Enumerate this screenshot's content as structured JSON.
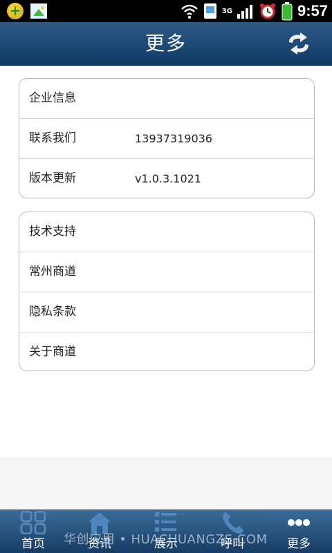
{
  "status_bar": {
    "time": "9:57",
    "network": "3G",
    "left_icons": [
      "app-badge-icon",
      "image-icon"
    ],
    "right_icons": [
      "wifi-icon",
      "sim-icon",
      "signal-icon",
      "alarm-icon",
      "battery-icon"
    ]
  },
  "header": {
    "title": "更多",
    "refresh_icon": "refresh-icon"
  },
  "groups": [
    {
      "rows": [
        {
          "label": "企业信息",
          "value": ""
        },
        {
          "label": "联系我们",
          "value": "13937319036"
        },
        {
          "label": "版本更新",
          "value": "v1.0.3.1021"
        }
      ]
    },
    {
      "rows": [
        {
          "label": "技术支持"
        },
        {
          "label": "常州商道"
        },
        {
          "label": "隐私条款"
        },
        {
          "label": "关于商道"
        }
      ]
    }
  ],
  "tabbar": {
    "items": [
      {
        "label": "首页",
        "icon": "grid-icon"
      },
      {
        "label": "资讯",
        "icon": "home-icon"
      },
      {
        "label": "展示",
        "icon": "list-icon"
      },
      {
        "label": "呼叫",
        "icon": "phone-icon"
      },
      {
        "label": "更多",
        "icon": "more-dots-icon"
      }
    ],
    "watermark": "华创应用 • HUACHUANGZS.COM"
  },
  "colors": {
    "header_top": "#2f5a86",
    "header_bottom": "#0f3a64",
    "tabbar_top": "#3c6d98",
    "tabbar_bottom": "#163c64",
    "status_bar": "#000000"
  }
}
